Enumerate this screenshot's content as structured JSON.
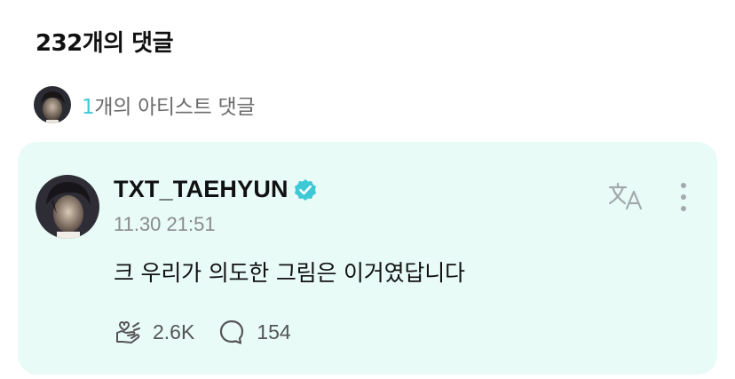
{
  "header": {
    "comment_count_title": "232개의 댓글"
  },
  "artist_summary": {
    "count": "1",
    "label": "개의 아티스트 댓글"
  },
  "comment": {
    "username": "TXT_TAEHYUN",
    "verified": true,
    "timestamp": "11.30 21:51",
    "text": "크 우리가 의도한 그림은 이거였답니다",
    "likes": "2.6K",
    "replies": "154"
  },
  "icons": {
    "verified": "verified-badge-icon",
    "translate": "translate-icon",
    "more": "more-vertical-icon",
    "like": "heart-hand-icon",
    "reply": "speech-bubble-icon"
  },
  "colors": {
    "accent": "#3ec9d6",
    "card_background": "#e8fbf6",
    "verified_badge": "#3ec9d6"
  }
}
